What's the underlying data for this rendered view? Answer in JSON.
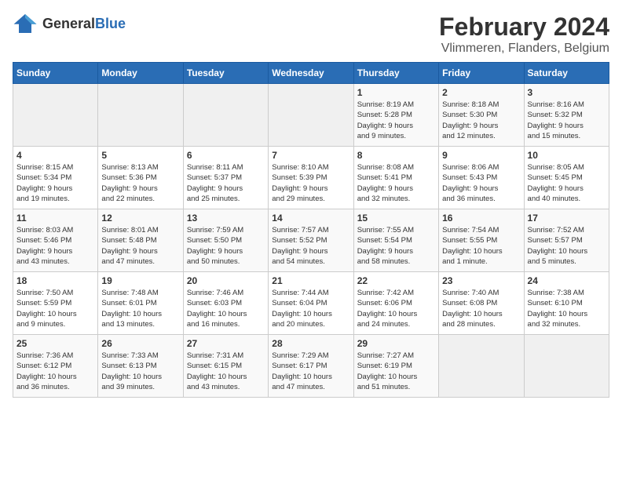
{
  "header": {
    "logo_general": "General",
    "logo_blue": "Blue",
    "month": "February 2024",
    "location": "Vlimmeren, Flanders, Belgium"
  },
  "weekdays": [
    "Sunday",
    "Monday",
    "Tuesday",
    "Wednesday",
    "Thursday",
    "Friday",
    "Saturday"
  ],
  "weeks": [
    [
      {
        "day": "",
        "info": ""
      },
      {
        "day": "",
        "info": ""
      },
      {
        "day": "",
        "info": ""
      },
      {
        "day": "",
        "info": ""
      },
      {
        "day": "1",
        "info": "Sunrise: 8:19 AM\nSunset: 5:28 PM\nDaylight: 9 hours\nand 9 minutes."
      },
      {
        "day": "2",
        "info": "Sunrise: 8:18 AM\nSunset: 5:30 PM\nDaylight: 9 hours\nand 12 minutes."
      },
      {
        "day": "3",
        "info": "Sunrise: 8:16 AM\nSunset: 5:32 PM\nDaylight: 9 hours\nand 15 minutes."
      }
    ],
    [
      {
        "day": "4",
        "info": "Sunrise: 8:15 AM\nSunset: 5:34 PM\nDaylight: 9 hours\nand 19 minutes."
      },
      {
        "day": "5",
        "info": "Sunrise: 8:13 AM\nSunset: 5:36 PM\nDaylight: 9 hours\nand 22 minutes."
      },
      {
        "day": "6",
        "info": "Sunrise: 8:11 AM\nSunset: 5:37 PM\nDaylight: 9 hours\nand 25 minutes."
      },
      {
        "day": "7",
        "info": "Sunrise: 8:10 AM\nSunset: 5:39 PM\nDaylight: 9 hours\nand 29 minutes."
      },
      {
        "day": "8",
        "info": "Sunrise: 8:08 AM\nSunset: 5:41 PM\nDaylight: 9 hours\nand 32 minutes."
      },
      {
        "day": "9",
        "info": "Sunrise: 8:06 AM\nSunset: 5:43 PM\nDaylight: 9 hours\nand 36 minutes."
      },
      {
        "day": "10",
        "info": "Sunrise: 8:05 AM\nSunset: 5:45 PM\nDaylight: 9 hours\nand 40 minutes."
      }
    ],
    [
      {
        "day": "11",
        "info": "Sunrise: 8:03 AM\nSunset: 5:46 PM\nDaylight: 9 hours\nand 43 minutes."
      },
      {
        "day": "12",
        "info": "Sunrise: 8:01 AM\nSunset: 5:48 PM\nDaylight: 9 hours\nand 47 minutes."
      },
      {
        "day": "13",
        "info": "Sunrise: 7:59 AM\nSunset: 5:50 PM\nDaylight: 9 hours\nand 50 minutes."
      },
      {
        "day": "14",
        "info": "Sunrise: 7:57 AM\nSunset: 5:52 PM\nDaylight: 9 hours\nand 54 minutes."
      },
      {
        "day": "15",
        "info": "Sunrise: 7:55 AM\nSunset: 5:54 PM\nDaylight: 9 hours\nand 58 minutes."
      },
      {
        "day": "16",
        "info": "Sunrise: 7:54 AM\nSunset: 5:55 PM\nDaylight: 10 hours\nand 1 minute."
      },
      {
        "day": "17",
        "info": "Sunrise: 7:52 AM\nSunset: 5:57 PM\nDaylight: 10 hours\nand 5 minutes."
      }
    ],
    [
      {
        "day": "18",
        "info": "Sunrise: 7:50 AM\nSunset: 5:59 PM\nDaylight: 10 hours\nand 9 minutes."
      },
      {
        "day": "19",
        "info": "Sunrise: 7:48 AM\nSunset: 6:01 PM\nDaylight: 10 hours\nand 13 minutes."
      },
      {
        "day": "20",
        "info": "Sunrise: 7:46 AM\nSunset: 6:03 PM\nDaylight: 10 hours\nand 16 minutes."
      },
      {
        "day": "21",
        "info": "Sunrise: 7:44 AM\nSunset: 6:04 PM\nDaylight: 10 hours\nand 20 minutes."
      },
      {
        "day": "22",
        "info": "Sunrise: 7:42 AM\nSunset: 6:06 PM\nDaylight: 10 hours\nand 24 minutes."
      },
      {
        "day": "23",
        "info": "Sunrise: 7:40 AM\nSunset: 6:08 PM\nDaylight: 10 hours\nand 28 minutes."
      },
      {
        "day": "24",
        "info": "Sunrise: 7:38 AM\nSunset: 6:10 PM\nDaylight: 10 hours\nand 32 minutes."
      }
    ],
    [
      {
        "day": "25",
        "info": "Sunrise: 7:36 AM\nSunset: 6:12 PM\nDaylight: 10 hours\nand 36 minutes."
      },
      {
        "day": "26",
        "info": "Sunrise: 7:33 AM\nSunset: 6:13 PM\nDaylight: 10 hours\nand 39 minutes."
      },
      {
        "day": "27",
        "info": "Sunrise: 7:31 AM\nSunset: 6:15 PM\nDaylight: 10 hours\nand 43 minutes."
      },
      {
        "day": "28",
        "info": "Sunrise: 7:29 AM\nSunset: 6:17 PM\nDaylight: 10 hours\nand 47 minutes."
      },
      {
        "day": "29",
        "info": "Sunrise: 7:27 AM\nSunset: 6:19 PM\nDaylight: 10 hours\nand 51 minutes."
      },
      {
        "day": "",
        "info": ""
      },
      {
        "day": "",
        "info": ""
      }
    ]
  ]
}
